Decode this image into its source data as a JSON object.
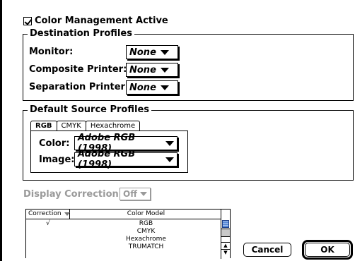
{
  "color_management": {
    "label": "Color Management Active",
    "checked": true
  },
  "destination": {
    "title": "Destination Profiles",
    "monitor": {
      "label": "Monitor:",
      "value": "None"
    },
    "composite": {
      "label": "Composite Printer:",
      "value": "None"
    },
    "separation": {
      "label": "Separation Printer:",
      "value": "None"
    }
  },
  "source": {
    "title": "Default Source Profiles",
    "tabs": [
      "RGB",
      "CMYK",
      "Hexachrome"
    ],
    "color": {
      "label": "Color:",
      "value": "Adobe RGB (1998)"
    },
    "image": {
      "label": "Image:",
      "value": "Adobe RGB (1998)"
    }
  },
  "display_correction": {
    "label": "Display Correction:",
    "value": "Off"
  },
  "table": {
    "headers": {
      "correction": "Correction",
      "model": "Color Model"
    },
    "rows": [
      {
        "check": "√",
        "model": "RGB"
      },
      {
        "check": "",
        "model": "CMYK"
      },
      {
        "check": "",
        "model": "Hexachrome"
      },
      {
        "check": "",
        "model": "TRUMATCH"
      }
    ]
  },
  "buttons": {
    "cancel": "Cancel",
    "ok": "OK"
  }
}
